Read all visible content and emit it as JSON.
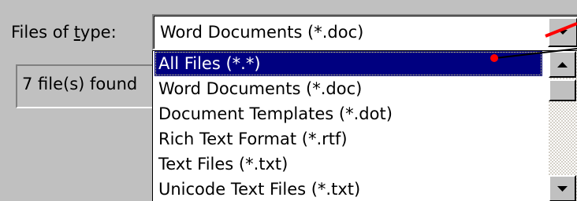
{
  "filter": {
    "label_prefix": "Files of ",
    "label_hotkey": "t",
    "label_suffix": "ype:",
    "value": "Word Documents (*.doc)"
  },
  "status": {
    "text": "7 file(s) found"
  },
  "dropdown": {
    "items": [
      {
        "label": "All Files (*.*)",
        "selected": true
      },
      {
        "label": "Word Documents (*.doc)",
        "selected": false
      },
      {
        "label": "Document Templates (*.dot)",
        "selected": false
      },
      {
        "label": "Rich Text Format (*.rtf)",
        "selected": false
      },
      {
        "label": "Text Files (*.txt)",
        "selected": false
      },
      {
        "label": "Unicode Text Files (*.txt)",
        "selected": false
      }
    ]
  },
  "icons": {
    "combo_arrow": "chevron-down-icon",
    "scroll_up": "scroll-up-arrow-icon",
    "scroll_down": "scroll-down-arrow-icon"
  },
  "colors": {
    "face": "#c0c0c0",
    "selection": "#000080",
    "annotation": "#ff0000"
  }
}
